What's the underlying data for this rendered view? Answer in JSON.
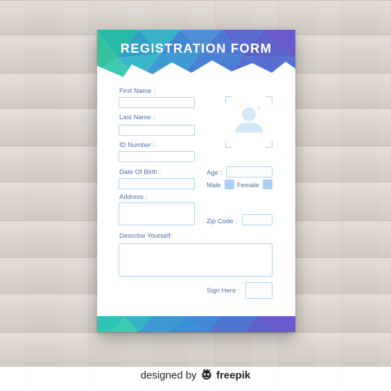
{
  "form": {
    "title": "REGISTRATION FORM",
    "labels": {
      "first_name": "First Name :",
      "last_name": "Last Name :",
      "id_number": "ID Number :",
      "dob": "Date Of Birth :",
      "age": "Age :",
      "male": "Male",
      "female": "Female",
      "address": "Address :",
      "zip": "Zip Code :",
      "describe": "Describe Yourself:",
      "sign": "Sign Here :"
    },
    "values": {
      "first_name": "",
      "last_name": "",
      "id_number": "",
      "dob": "",
      "age": "",
      "address": "",
      "zip": "",
      "describe": "",
      "sign": ""
    },
    "photo_icon": "user-avatar-icon"
  },
  "branding": {
    "prefix": "designed by",
    "name": "freepik",
    "logo_icon": "freepik-logo-icon"
  },
  "colors": {
    "label": "#4a6fa8",
    "field_border": "#a9d0f0",
    "header_gradient": [
      "#2ec4b6",
      "#3a7bd5",
      "#6a5acd"
    ]
  }
}
